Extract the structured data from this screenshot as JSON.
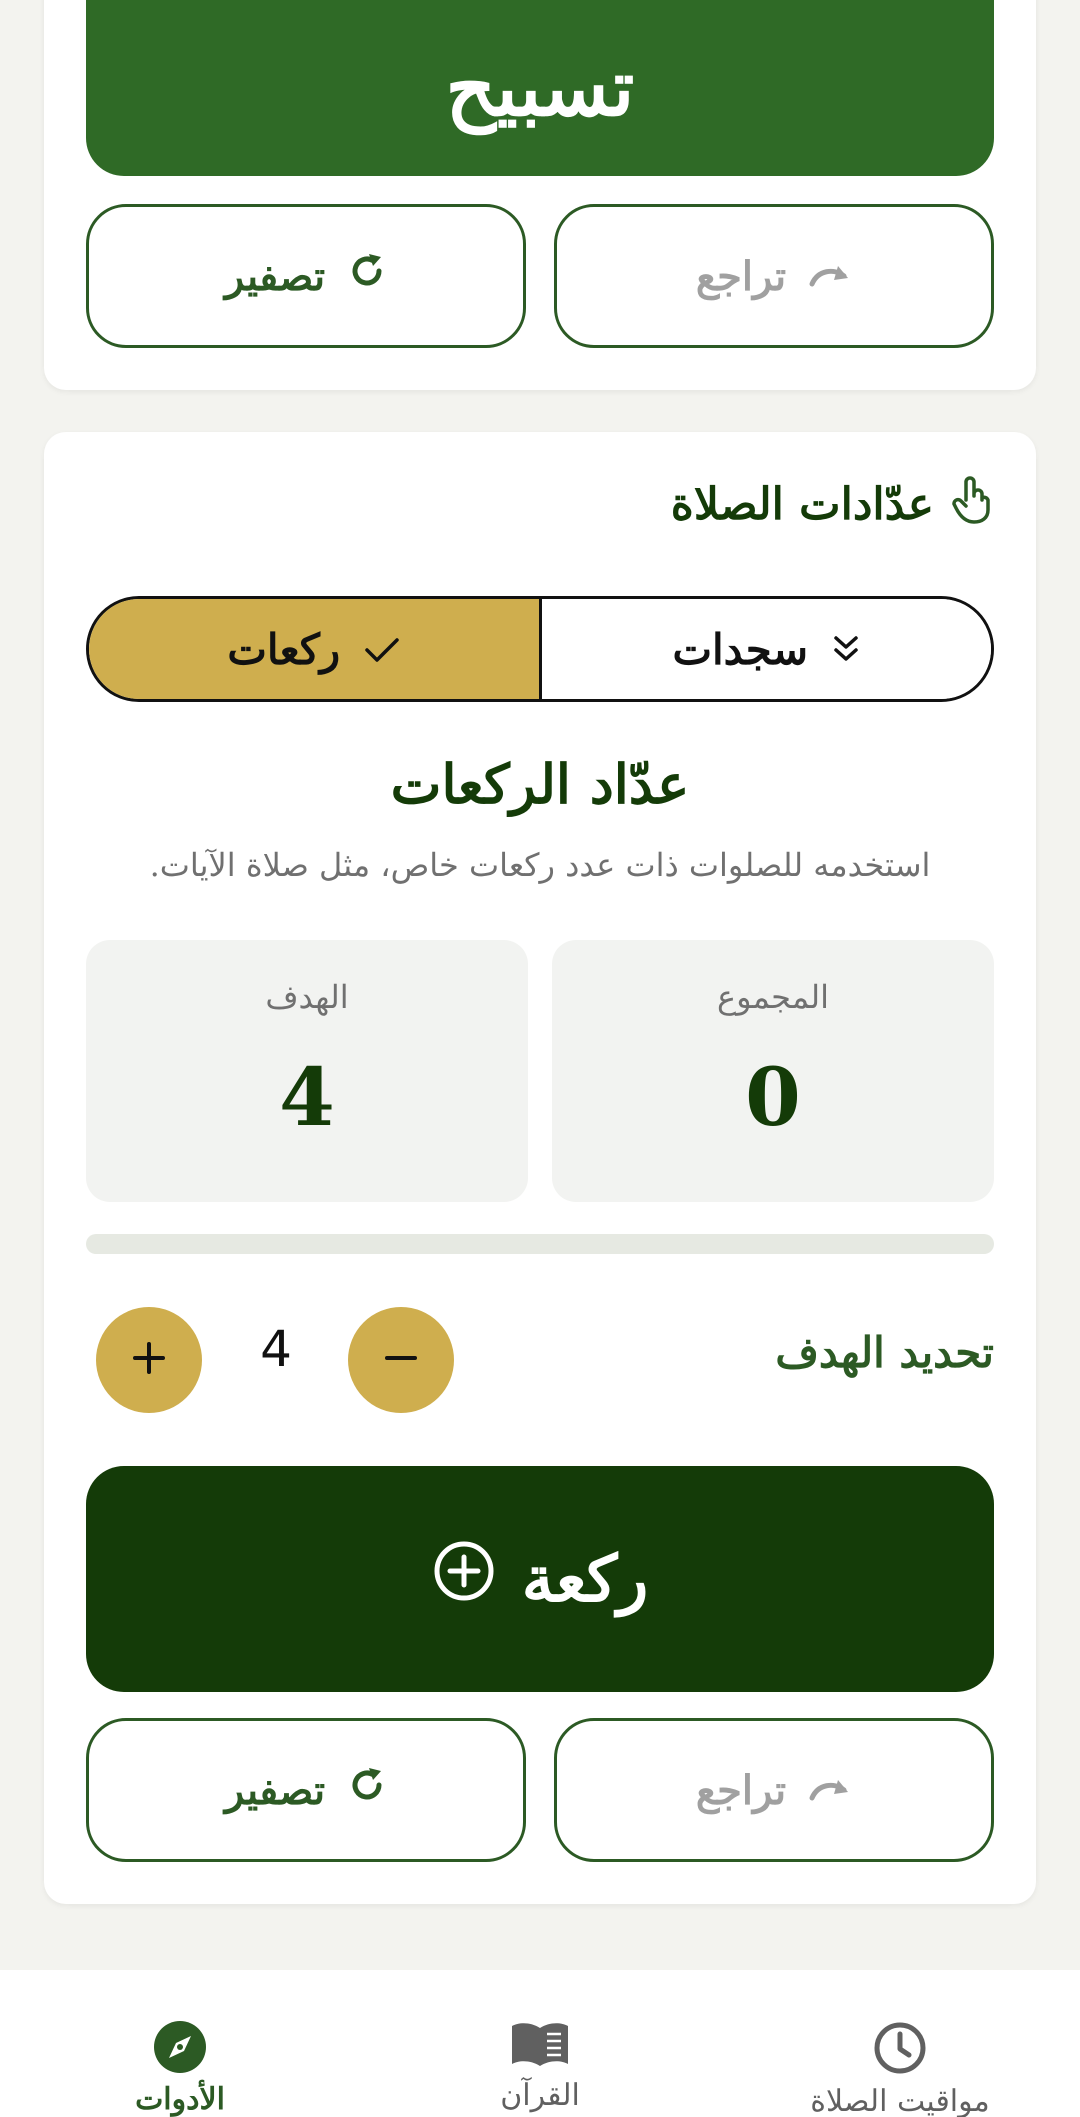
{
  "tasbih": {
    "main_button_label": "تسبيح",
    "undo_label": "تراجع",
    "reset_label": "تصفير"
  },
  "prayer_counters": {
    "section_title": "عدّادات الصلاة",
    "tabs": [
      {
        "label": "ركعات",
        "active": true
      },
      {
        "label": "سجدات",
        "active": false
      }
    ],
    "counter_title": "عدّاد الركعات",
    "counter_subtitle": "استخدمه للصلوات ذات عدد ركعات خاص، مثل صلاة الآيات.",
    "total_label": "المجموع",
    "total_value": "0",
    "goal_label": "الهدف",
    "goal_value": "4",
    "progress_fraction": 0,
    "set_goal_label": "تحديد الهدف",
    "goal_stepper_value": "4",
    "rakah_button_label": "ركعة",
    "undo_label": "تراجع",
    "reset_label": "تصفير"
  },
  "bottom_nav": {
    "items": [
      {
        "label": "مواقيت الصلاة",
        "icon": "clock-icon",
        "active": false
      },
      {
        "label": "القرآن",
        "icon": "book-icon",
        "active": false
      },
      {
        "label": "الأدوات",
        "icon": "compass-icon",
        "active": true
      }
    ]
  },
  "colors": {
    "primary_green": "#2f6a26",
    "dark_green": "#143b08",
    "gold": "#cfae4e",
    "background": "#f3f3ef"
  }
}
